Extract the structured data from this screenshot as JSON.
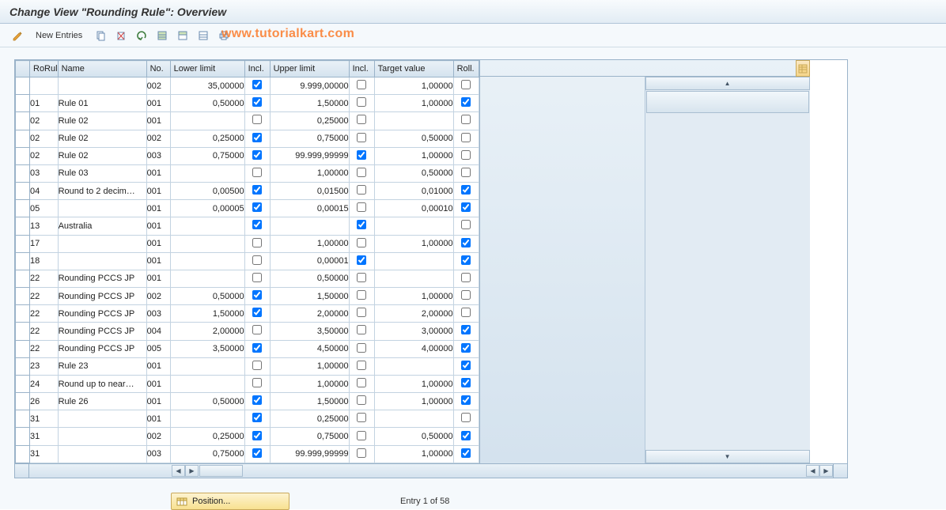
{
  "title": "Change View \"Rounding Rule\": Overview",
  "watermark": "www.tutorialkart.com",
  "toolbar": {
    "new_entries": "New Entries"
  },
  "columns": {
    "rorul": "RoRul",
    "name": "Name",
    "no": "No.",
    "lower": "Lower limit",
    "incl1": "Incl.",
    "upper": "Upper limit",
    "incl2": "Incl.",
    "target": "Target value",
    "roll": "Roll."
  },
  "rows": [
    {
      "rorul": "",
      "name": "",
      "no": "002",
      "lower": "35,00000",
      "incl1": true,
      "upper": "9.999,00000",
      "incl2": false,
      "target": "1,00000",
      "roll": false
    },
    {
      "rorul": "01",
      "name": "Rule 01",
      "no": "001",
      "lower": "0,50000",
      "incl1": true,
      "upper": "1,50000",
      "incl2": false,
      "target": "1,00000",
      "roll": true
    },
    {
      "rorul": "02",
      "name": "Rule 02",
      "no": "001",
      "lower": "",
      "incl1": false,
      "upper": "0,25000",
      "incl2": false,
      "target": "",
      "roll": false
    },
    {
      "rorul": "02",
      "name": "Rule 02",
      "no": "002",
      "lower": "0,25000",
      "incl1": true,
      "upper": "0,75000",
      "incl2": false,
      "target": "0,50000",
      "roll": false
    },
    {
      "rorul": "02",
      "name": "Rule 02",
      "no": "003",
      "lower": "0,75000",
      "incl1": true,
      "upper": "99.999,99999",
      "incl2": true,
      "target": "1,00000",
      "roll": false
    },
    {
      "rorul": "03",
      "name": "Rule 03",
      "no": "001",
      "lower": "",
      "incl1": false,
      "upper": "1,00000",
      "incl2": false,
      "target": "0,50000",
      "roll": false
    },
    {
      "rorul": "04",
      "name": "Round to 2 decim…",
      "no": "001",
      "lower": "0,00500",
      "incl1": true,
      "upper": "0,01500",
      "incl2": false,
      "target": "0,01000",
      "roll": true
    },
    {
      "rorul": "05",
      "name": "",
      "no": "001",
      "lower": "0,00005",
      "incl1": true,
      "upper": "0,00015",
      "incl2": false,
      "target": "0,00010",
      "roll": true
    },
    {
      "rorul": "13",
      "name": "Australia",
      "no": "001",
      "lower": "",
      "incl1": true,
      "upper": "",
      "incl2": true,
      "target": "",
      "roll": false
    },
    {
      "rorul": "17",
      "name": "",
      "no": "001",
      "lower": "",
      "incl1": false,
      "upper": "1,00000",
      "incl2": false,
      "target": "1,00000",
      "roll": true
    },
    {
      "rorul": "18",
      "name": "",
      "no": "001",
      "lower": "",
      "incl1": false,
      "upper": "0,00001",
      "incl2": true,
      "target": "",
      "roll": true
    },
    {
      "rorul": "22",
      "name": "Rounding PCCS JP",
      "no": "001",
      "lower": "",
      "incl1": false,
      "upper": "0,50000",
      "incl2": false,
      "target": "",
      "roll": false
    },
    {
      "rorul": "22",
      "name": "Rounding PCCS JP",
      "no": "002",
      "lower": "0,50000",
      "incl1": true,
      "upper": "1,50000",
      "incl2": false,
      "target": "1,00000",
      "roll": false
    },
    {
      "rorul": "22",
      "name": "Rounding PCCS JP",
      "no": "003",
      "lower": "1,50000",
      "incl1": true,
      "upper": "2,00000",
      "incl2": false,
      "target": "2,00000",
      "roll": false
    },
    {
      "rorul": "22",
      "name": "Rounding PCCS JP",
      "no": "004",
      "lower": "2,00000",
      "incl1": false,
      "upper": "3,50000",
      "incl2": false,
      "target": "3,00000",
      "roll": true
    },
    {
      "rorul": "22",
      "name": "Rounding PCCS JP",
      "no": "005",
      "lower": "3,50000",
      "incl1": true,
      "upper": "4,50000",
      "incl2": false,
      "target": "4,00000",
      "roll": true
    },
    {
      "rorul": "23",
      "name": "Rule 23",
      "no": "001",
      "lower": "",
      "incl1": false,
      "upper": "1,00000",
      "incl2": false,
      "target": "",
      "roll": true
    },
    {
      "rorul": "24",
      "name": "Round up to near…",
      "no": "001",
      "lower": "",
      "incl1": false,
      "upper": "1,00000",
      "incl2": false,
      "target": "1,00000",
      "roll": true
    },
    {
      "rorul": "26",
      "name": "Rule 26",
      "no": "001",
      "lower": "0,50000",
      "incl1": true,
      "upper": "1,50000",
      "incl2": false,
      "target": "1,00000",
      "roll": true
    },
    {
      "rorul": "31",
      "name": "",
      "no": "001",
      "lower": "",
      "incl1": true,
      "upper": "0,25000",
      "incl2": false,
      "target": "",
      "roll": false
    },
    {
      "rorul": "31",
      "name": "",
      "no": "002",
      "lower": "0,25000",
      "incl1": true,
      "upper": "0,75000",
      "incl2": false,
      "target": "0,50000",
      "roll": true
    },
    {
      "rorul": "31",
      "name": "",
      "no": "003",
      "lower": "0,75000",
      "incl1": true,
      "upper": "99.999,99999",
      "incl2": false,
      "target": "1,00000",
      "roll": true
    }
  ],
  "footer": {
    "position_label": "Position...",
    "entry_counter": "Entry 1 of 58"
  }
}
